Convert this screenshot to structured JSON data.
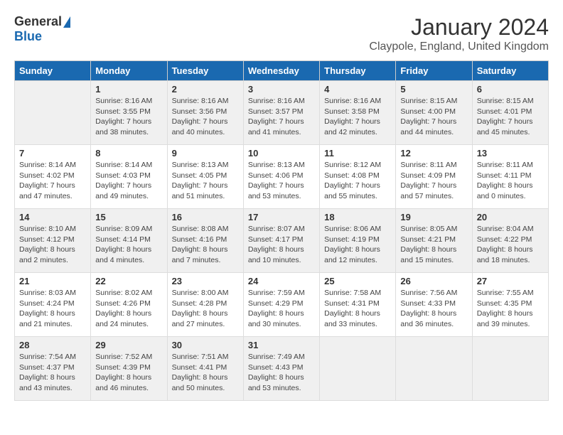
{
  "logo": {
    "general": "General",
    "blue": "Blue"
  },
  "title": "January 2024",
  "subtitle": "Claypole, England, United Kingdom",
  "days_of_week": [
    "Sunday",
    "Monday",
    "Tuesday",
    "Wednesday",
    "Thursday",
    "Friday",
    "Saturday"
  ],
  "weeks": [
    [
      {
        "date": "",
        "sunrise": "",
        "sunset": "",
        "daylight": ""
      },
      {
        "date": "1",
        "sunrise": "Sunrise: 8:16 AM",
        "sunset": "Sunset: 3:55 PM",
        "daylight": "Daylight: 7 hours and 38 minutes."
      },
      {
        "date": "2",
        "sunrise": "Sunrise: 8:16 AM",
        "sunset": "Sunset: 3:56 PM",
        "daylight": "Daylight: 7 hours and 40 minutes."
      },
      {
        "date": "3",
        "sunrise": "Sunrise: 8:16 AM",
        "sunset": "Sunset: 3:57 PM",
        "daylight": "Daylight: 7 hours and 41 minutes."
      },
      {
        "date": "4",
        "sunrise": "Sunrise: 8:16 AM",
        "sunset": "Sunset: 3:58 PM",
        "daylight": "Daylight: 7 hours and 42 minutes."
      },
      {
        "date": "5",
        "sunrise": "Sunrise: 8:15 AM",
        "sunset": "Sunset: 4:00 PM",
        "daylight": "Daylight: 7 hours and 44 minutes."
      },
      {
        "date": "6",
        "sunrise": "Sunrise: 8:15 AM",
        "sunset": "Sunset: 4:01 PM",
        "daylight": "Daylight: 7 hours and 45 minutes."
      }
    ],
    [
      {
        "date": "7",
        "sunrise": "Sunrise: 8:14 AM",
        "sunset": "Sunset: 4:02 PM",
        "daylight": "Daylight: 7 hours and 47 minutes."
      },
      {
        "date": "8",
        "sunrise": "Sunrise: 8:14 AM",
        "sunset": "Sunset: 4:03 PM",
        "daylight": "Daylight: 7 hours and 49 minutes."
      },
      {
        "date": "9",
        "sunrise": "Sunrise: 8:13 AM",
        "sunset": "Sunset: 4:05 PM",
        "daylight": "Daylight: 7 hours and 51 minutes."
      },
      {
        "date": "10",
        "sunrise": "Sunrise: 8:13 AM",
        "sunset": "Sunset: 4:06 PM",
        "daylight": "Daylight: 7 hours and 53 minutes."
      },
      {
        "date": "11",
        "sunrise": "Sunrise: 8:12 AM",
        "sunset": "Sunset: 4:08 PM",
        "daylight": "Daylight: 7 hours and 55 minutes."
      },
      {
        "date": "12",
        "sunrise": "Sunrise: 8:11 AM",
        "sunset": "Sunset: 4:09 PM",
        "daylight": "Daylight: 7 hours and 57 minutes."
      },
      {
        "date": "13",
        "sunrise": "Sunrise: 8:11 AM",
        "sunset": "Sunset: 4:11 PM",
        "daylight": "Daylight: 8 hours and 0 minutes."
      }
    ],
    [
      {
        "date": "14",
        "sunrise": "Sunrise: 8:10 AM",
        "sunset": "Sunset: 4:12 PM",
        "daylight": "Daylight: 8 hours and 2 minutes."
      },
      {
        "date": "15",
        "sunrise": "Sunrise: 8:09 AM",
        "sunset": "Sunset: 4:14 PM",
        "daylight": "Daylight: 8 hours and 4 minutes."
      },
      {
        "date": "16",
        "sunrise": "Sunrise: 8:08 AM",
        "sunset": "Sunset: 4:16 PM",
        "daylight": "Daylight: 8 hours and 7 minutes."
      },
      {
        "date": "17",
        "sunrise": "Sunrise: 8:07 AM",
        "sunset": "Sunset: 4:17 PM",
        "daylight": "Daylight: 8 hours and 10 minutes."
      },
      {
        "date": "18",
        "sunrise": "Sunrise: 8:06 AM",
        "sunset": "Sunset: 4:19 PM",
        "daylight": "Daylight: 8 hours and 12 minutes."
      },
      {
        "date": "19",
        "sunrise": "Sunrise: 8:05 AM",
        "sunset": "Sunset: 4:21 PM",
        "daylight": "Daylight: 8 hours and 15 minutes."
      },
      {
        "date": "20",
        "sunrise": "Sunrise: 8:04 AM",
        "sunset": "Sunset: 4:22 PM",
        "daylight": "Daylight: 8 hours and 18 minutes."
      }
    ],
    [
      {
        "date": "21",
        "sunrise": "Sunrise: 8:03 AM",
        "sunset": "Sunset: 4:24 PM",
        "daylight": "Daylight: 8 hours and 21 minutes."
      },
      {
        "date": "22",
        "sunrise": "Sunrise: 8:02 AM",
        "sunset": "Sunset: 4:26 PM",
        "daylight": "Daylight: 8 hours and 24 minutes."
      },
      {
        "date": "23",
        "sunrise": "Sunrise: 8:00 AM",
        "sunset": "Sunset: 4:28 PM",
        "daylight": "Daylight: 8 hours and 27 minutes."
      },
      {
        "date": "24",
        "sunrise": "Sunrise: 7:59 AM",
        "sunset": "Sunset: 4:29 PM",
        "daylight": "Daylight: 8 hours and 30 minutes."
      },
      {
        "date": "25",
        "sunrise": "Sunrise: 7:58 AM",
        "sunset": "Sunset: 4:31 PM",
        "daylight": "Daylight: 8 hours and 33 minutes."
      },
      {
        "date": "26",
        "sunrise": "Sunrise: 7:56 AM",
        "sunset": "Sunset: 4:33 PM",
        "daylight": "Daylight: 8 hours and 36 minutes."
      },
      {
        "date": "27",
        "sunrise": "Sunrise: 7:55 AM",
        "sunset": "Sunset: 4:35 PM",
        "daylight": "Daylight: 8 hours and 39 minutes."
      }
    ],
    [
      {
        "date": "28",
        "sunrise": "Sunrise: 7:54 AM",
        "sunset": "Sunset: 4:37 PM",
        "daylight": "Daylight: 8 hours and 43 minutes."
      },
      {
        "date": "29",
        "sunrise": "Sunrise: 7:52 AM",
        "sunset": "Sunset: 4:39 PM",
        "daylight": "Daylight: 8 hours and 46 minutes."
      },
      {
        "date": "30",
        "sunrise": "Sunrise: 7:51 AM",
        "sunset": "Sunset: 4:41 PM",
        "daylight": "Daylight: 8 hours and 50 minutes."
      },
      {
        "date": "31",
        "sunrise": "Sunrise: 7:49 AM",
        "sunset": "Sunset: 4:43 PM",
        "daylight": "Daylight: 8 hours and 53 minutes."
      },
      {
        "date": "",
        "sunrise": "",
        "sunset": "",
        "daylight": ""
      },
      {
        "date": "",
        "sunrise": "",
        "sunset": "",
        "daylight": ""
      },
      {
        "date": "",
        "sunrise": "",
        "sunset": "",
        "daylight": ""
      }
    ]
  ]
}
